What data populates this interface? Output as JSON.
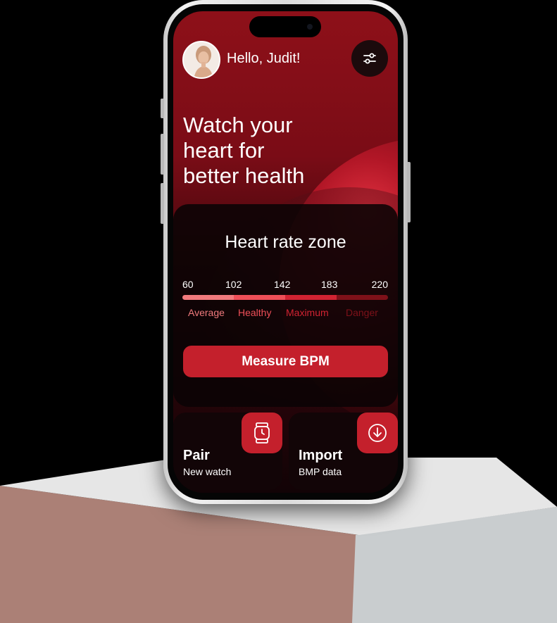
{
  "header": {
    "greeting": "Hello, Judit!"
  },
  "hero": {
    "line1": "Watch your",
    "line2": "heart for",
    "line3": "better health"
  },
  "heart_rate_card": {
    "title": "Heart rate zone",
    "thresholds": [
      "60",
      "102",
      "142",
      "183",
      "220"
    ],
    "zones": [
      {
        "label": "Average",
        "color": "#f07a7d"
      },
      {
        "label": "Healthy",
        "color": "#ee4f58"
      },
      {
        "label": "Maximum",
        "color": "#d12332"
      },
      {
        "label": "Danger",
        "color": "#7e1119"
      }
    ],
    "measure_button": "Measure BPM"
  },
  "tiles": [
    {
      "title": "Pair",
      "subtitle": "New watch",
      "icon": "watch-icon"
    },
    {
      "title": "Import",
      "subtitle": "BMP data",
      "icon": "download-icon"
    }
  ],
  "colors": {
    "accent": "#c4202c",
    "screen_top": "#8e1019",
    "card_bg": "#0a0305"
  }
}
